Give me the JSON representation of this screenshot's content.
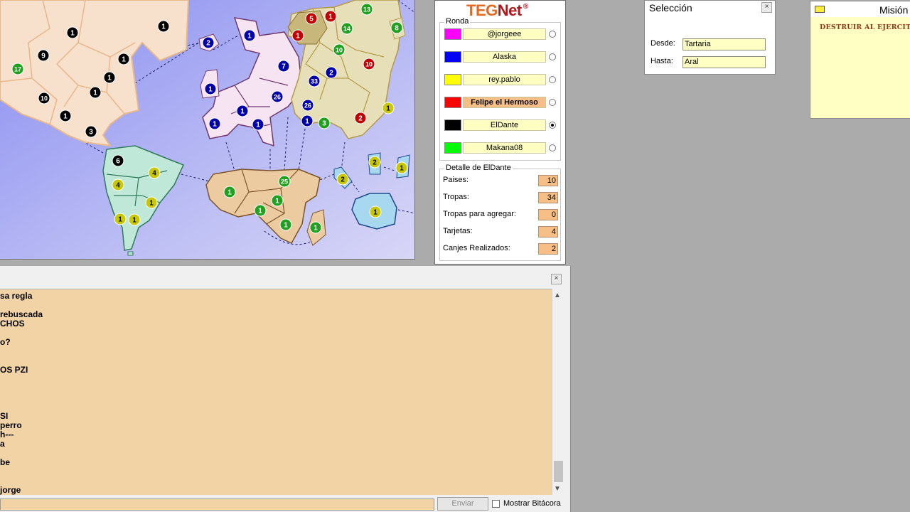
{
  "map": {
    "territories": [
      {
        "owner": "black",
        "troops": "1"
      },
      {
        "owner": "black",
        "troops": "1"
      },
      {
        "owner": "black",
        "troops": "9"
      },
      {
        "owner": "green",
        "troops": "17"
      },
      {
        "owner": "black",
        "troops": "10"
      },
      {
        "owner": "black",
        "troops": "1"
      },
      {
        "owner": "black",
        "troops": "1"
      },
      {
        "owner": "black",
        "troops": "1"
      },
      {
        "owner": "black",
        "troops": "1"
      },
      {
        "owner": "black",
        "troops": "3"
      },
      {
        "owner": "blue",
        "troops": "2"
      },
      {
        "owner": "blue",
        "troops": "1"
      },
      {
        "owner": "blue",
        "troops": "1"
      },
      {
        "owner": "blue",
        "troops": "1"
      },
      {
        "owner": "blue",
        "troops": "1"
      },
      {
        "owner": "blue",
        "troops": "1"
      },
      {
        "owner": "blue",
        "troops": "26"
      },
      {
        "owner": "blue",
        "troops": "7"
      },
      {
        "owner": "blue",
        "troops": "33"
      },
      {
        "owner": "blue",
        "troops": "2"
      },
      {
        "owner": "blue",
        "troops": "26"
      },
      {
        "owner": "blue",
        "troops": "1"
      },
      {
        "owner": "green",
        "troops": "3"
      },
      {
        "owner": "red",
        "troops": "5"
      },
      {
        "owner": "red",
        "troops": "1"
      },
      {
        "owner": "red",
        "troops": "1"
      },
      {
        "owner": "green",
        "troops": "13"
      },
      {
        "owner": "green",
        "troops": "14"
      },
      {
        "owner": "green",
        "troops": "10"
      },
      {
        "owner": "red",
        "troops": "10"
      },
      {
        "owner": "red",
        "troops": "2"
      },
      {
        "owner": "yellow",
        "troops": "1"
      },
      {
        "owner": "green",
        "troops": "8"
      },
      {
        "owner": "black",
        "troops": "6"
      },
      {
        "owner": "yellow",
        "troops": "4"
      },
      {
        "owner": "yellow",
        "troops": "4"
      },
      {
        "owner": "yellow",
        "troops": "1"
      },
      {
        "owner": "yellow",
        "troops": "1"
      },
      {
        "owner": "yellow",
        "troops": "1"
      },
      {
        "owner": "green",
        "troops": "1"
      },
      {
        "owner": "green",
        "troops": "25"
      },
      {
        "owner": "green",
        "troops": "1"
      },
      {
        "owner": "green",
        "troops": "1"
      },
      {
        "owner": "green",
        "troops": "1"
      },
      {
        "owner": "green",
        "troops": "1"
      },
      {
        "owner": "yellow",
        "troops": "2"
      },
      {
        "owner": "yellow",
        "troops": "2"
      },
      {
        "owner": "yellow",
        "troops": "1"
      },
      {
        "owner": "yellow",
        "troops": "1"
      }
    ]
  },
  "teg": {
    "logo_teg": "TEG",
    "logo_net": "Net",
    "logo_reg": "®",
    "ronda_title": "Ronda",
    "players": [
      {
        "color": "#ff00ff",
        "name": "@jorgeee",
        "active": false,
        "selected": false
      },
      {
        "color": "#0000ff",
        "name": "Alaska",
        "active": false,
        "selected": false
      },
      {
        "color": "#ffff00",
        "name": "rey.pablo",
        "active": false,
        "selected": false
      },
      {
        "color": "#ff0000",
        "name": "Felipe el Hermoso",
        "active": true,
        "selected": false
      },
      {
        "color": "#000000",
        "name": "ElDante",
        "active": false,
        "selected": true
      },
      {
        "color": "#00ff00",
        "name": "Makana08",
        "active": false,
        "selected": false
      }
    ],
    "detalle_title": "Detalle de ElDante",
    "detalle": [
      {
        "label": "Paises:",
        "value": "10"
      },
      {
        "label": "Tropas:",
        "value": "34"
      },
      {
        "label": "Tropas para agregar:",
        "value": "0"
      },
      {
        "label": "Tarjetas:",
        "value": "4"
      },
      {
        "label": "Canjes Realizados:",
        "value": "2"
      }
    ]
  },
  "seleccion": {
    "title": "Selección",
    "close": "×",
    "desde_label": "Desde:",
    "desde_value": "Tartaria",
    "hasta_label": "Hasta:",
    "hasta_value": "Aral"
  },
  "mision": {
    "title": "Misión",
    "text": "DESTRUIR AL EJERCITO"
  },
  "chat": {
    "close": "×",
    "lines": [
      "sa regla",
      "",
      "rebuscada",
      "CHOS",
      "",
      "o?",
      "",
      "",
      "OS PZI",
      "",
      "",
      "",
      "",
      " SI",
      "perro",
      "h---",
      "a",
      "",
      "be",
      "",
      "",
      " jorge"
    ],
    "scroll_up": "▲",
    "scroll_down": "▼",
    "send_label": "Enviar",
    "bitacora_label": "Mostrar Bitácora"
  },
  "colors": {
    "black": "#000000",
    "blue": "#0000a8",
    "red": "#c00000",
    "green": "#1fa01f",
    "yellow": "#c8c800"
  }
}
